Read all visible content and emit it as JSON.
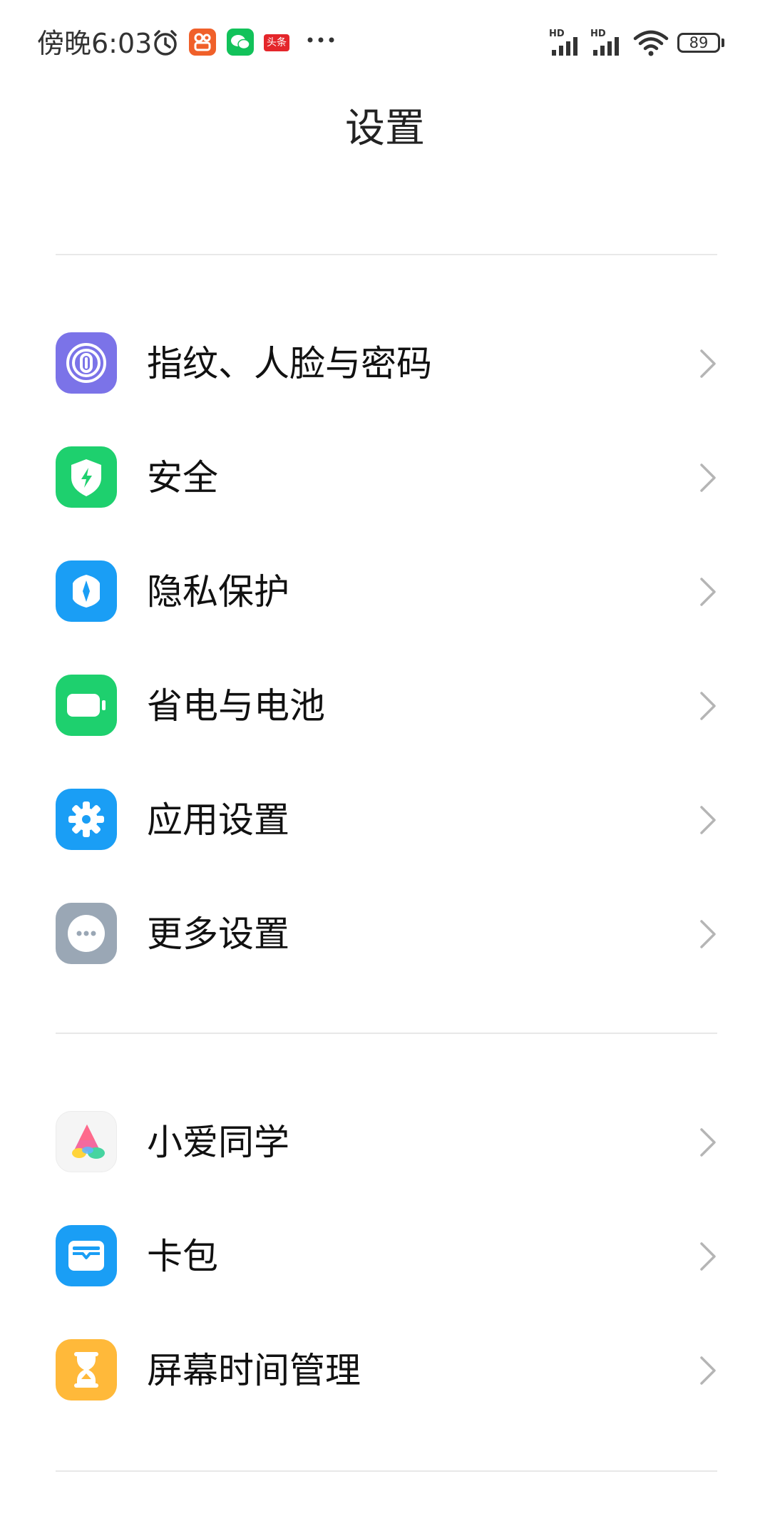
{
  "status_bar": {
    "time": "傍晚6:03",
    "hd1": "HD",
    "hd2": "HD",
    "battery": "89",
    "toutiao_badge": "头条"
  },
  "header": {
    "title": "设置"
  },
  "sections": [
    {
      "items": [
        {
          "label": "指纹、人脸与密码",
          "icon": "fingerprint-icon",
          "color": "#7b73e8"
        },
        {
          "label": "安全",
          "icon": "shield-bolt-icon",
          "color": "#1ed06e"
        },
        {
          "label": "隐私保护",
          "icon": "privacy-icon",
          "color": "#1a9ef5"
        },
        {
          "label": "省电与电池",
          "icon": "battery-saver-icon",
          "color": "#1ed06e"
        },
        {
          "label": "应用设置",
          "icon": "gear-icon",
          "color": "#1a9ef5"
        },
        {
          "label": "更多设置",
          "icon": "more-icon",
          "color": "#9aa7b5"
        }
      ]
    },
    {
      "items": [
        {
          "label": "小爱同学",
          "icon": "xiaoai-icon",
          "color": "#f5f5f5"
        },
        {
          "label": "卡包",
          "icon": "wallet-icon",
          "color": "#1a9ef5"
        },
        {
          "label": "屏幕时间管理",
          "icon": "hourglass-icon",
          "color": "#ffb93a"
        }
      ]
    }
  ]
}
